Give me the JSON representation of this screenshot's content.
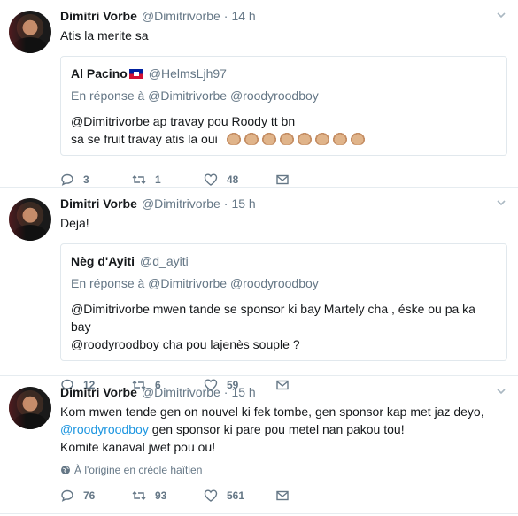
{
  "tweets": [
    {
      "name": "Dimitri Vorbe",
      "handle": "@Dimitrivorbe",
      "time": "14 h",
      "text": "Atis la merite sa",
      "quote": {
        "name": "Al Pacino",
        "handle": "@HelmsLjh97",
        "reply_to": "En réponse à @Dimitrivorbe @roodyroodboy",
        "line1": "@Dimitrivorbe  ap travay pou Roody tt bn",
        "line2": "sa se fruit travay atis la oui"
      },
      "replies": "3",
      "retweets": "1",
      "likes": "48"
    },
    {
      "name": "Dimitri Vorbe",
      "handle": "@Dimitrivorbe",
      "time": "15 h",
      "text": "Deja!",
      "quote": {
        "name": "Nèg d'Ayiti",
        "handle": "@d_ayiti",
        "reply_to": "En réponse à @Dimitrivorbe @roodyroodboy",
        "line1": "@Dimitrivorbe mwen tande se sponsor ki bay Martely cha , éske ou pa ka bay",
        "line2": "@roodyroodboy cha pou lajenès souple ?"
      },
      "replies": "12",
      "retweets": "6",
      "likes": "59"
    },
    {
      "name": "Dimitri Vorbe",
      "handle": "@Dimitrivorbe",
      "time": "15 h",
      "line1": "Kom mwen tende gen on nouvel ki fek tombe, gen sponsor kap met jaz deyo,",
      "line2_link": "@roodyroodboy",
      "line2_rest": " gen sponsor ki pare pou metel nan pakou tou!",
      "line3": "Komite kanaval jwet pou ou!",
      "translate": "À l'origine en créole haïtien",
      "replies": "76",
      "retweets": "93",
      "likes": "561"
    }
  ],
  "separator": "·"
}
